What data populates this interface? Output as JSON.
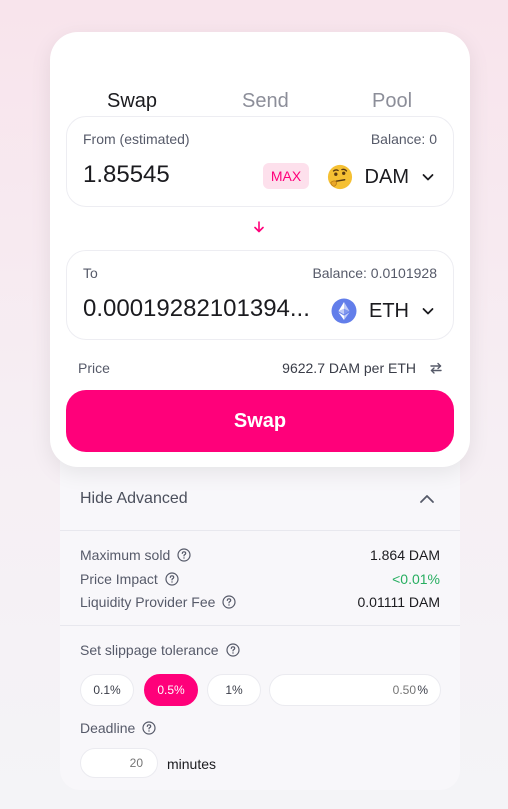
{
  "tabs": [
    {
      "label": "Swap",
      "active": true
    },
    {
      "label": "Send",
      "active": false
    },
    {
      "label": "Pool",
      "active": false
    }
  ],
  "from": {
    "label": "From (estimated)",
    "balance": "Balance: 0",
    "amount": "1.85545",
    "max_label": "MAX",
    "token": "DAM",
    "token_icon": "thinking-face-emoji"
  },
  "to": {
    "label": "To",
    "balance": "Balance: 0.0101928",
    "amount": "0.00019282101394...",
    "token": "ETH",
    "token_icon": "ethereum-icon"
  },
  "price": {
    "label": "Price",
    "value": "9622.7 DAM per ETH"
  },
  "swap_button": "Swap",
  "advanced": {
    "toggle_label": "Hide Advanced",
    "details": [
      {
        "label": "Maximum sold",
        "value": "1.864 DAM"
      },
      {
        "label": "Price Impact",
        "value": "<0.01%"
      },
      {
        "label": "Liquidity Provider Fee",
        "value": "0.01111 DAM"
      }
    ],
    "slippage": {
      "label": "Set slippage tolerance",
      "options": [
        "0.1%",
        "0.5%",
        "1%"
      ],
      "selected": "0.5%",
      "custom_placeholder": "0.50",
      "custom_suffix": "%"
    },
    "deadline": {
      "label": "Deadline",
      "placeholder": "20",
      "unit": "minutes"
    }
  },
  "colors": {
    "accent": "#ff007a",
    "accent_light": "#fde0ec",
    "positive": "#27ae60"
  }
}
